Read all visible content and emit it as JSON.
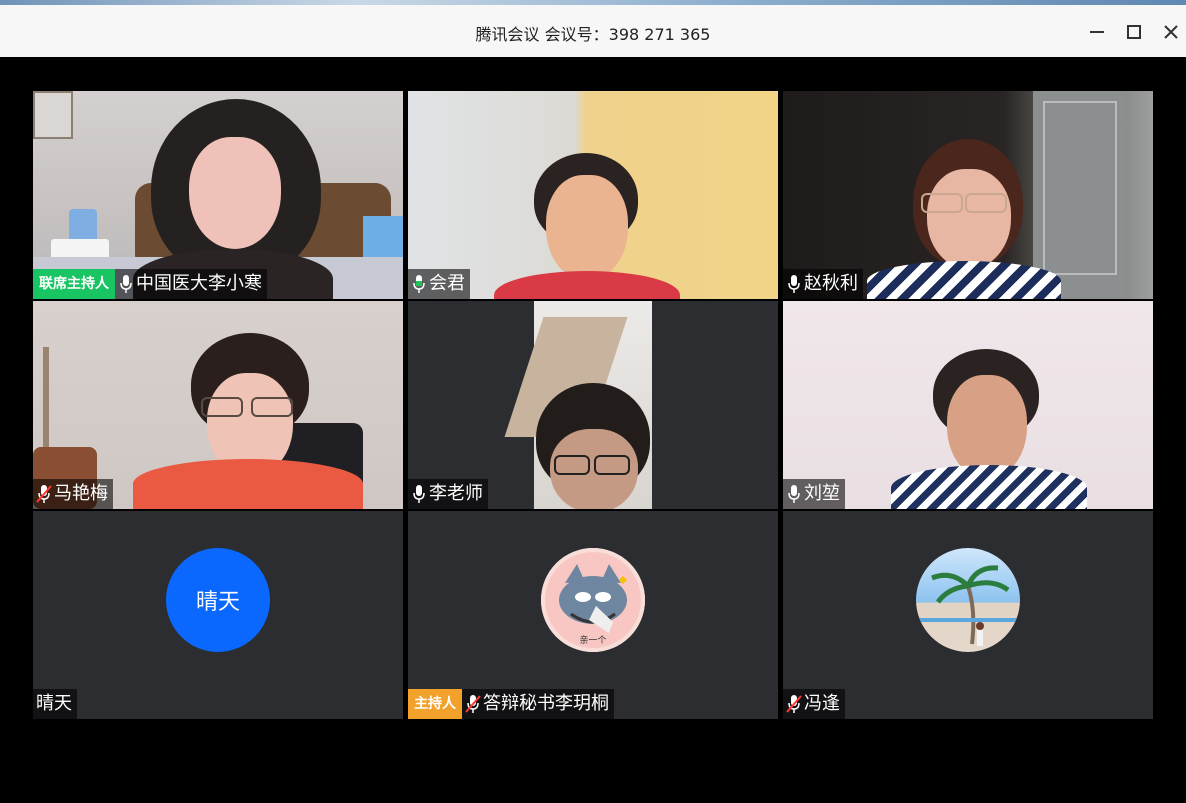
{
  "window": {
    "title": "腾讯会议 会议号：398 271 365",
    "controls": [
      "minimize-icon",
      "maximize-icon",
      "close-icon"
    ]
  },
  "participants": [
    {
      "name": "中国医大李小寒",
      "role_badge": "联席主持人",
      "mic": "on"
    },
    {
      "name": "会君",
      "mic": "on"
    },
    {
      "name": "赵秋利",
      "mic": "on"
    },
    {
      "name": "马艳梅",
      "mic": "muted"
    },
    {
      "name": "李老师",
      "mic": "on"
    },
    {
      "name": "刘堃",
      "mic": "on"
    },
    {
      "name": "晴天",
      "avatar_text": "晴天",
      "mic": "none"
    },
    {
      "name": "答辩秘书李玥桐",
      "role_badge": "主持人",
      "mic": "muted",
      "avatar_caption": "亲一个"
    },
    {
      "name": "冯逢",
      "mic": "muted"
    }
  ],
  "colors": {
    "green_badge": "#19c463",
    "orange_badge": "#f2a12a",
    "blue_avatar": "#0a68ff",
    "empty_tile": "#2b2d30"
  }
}
